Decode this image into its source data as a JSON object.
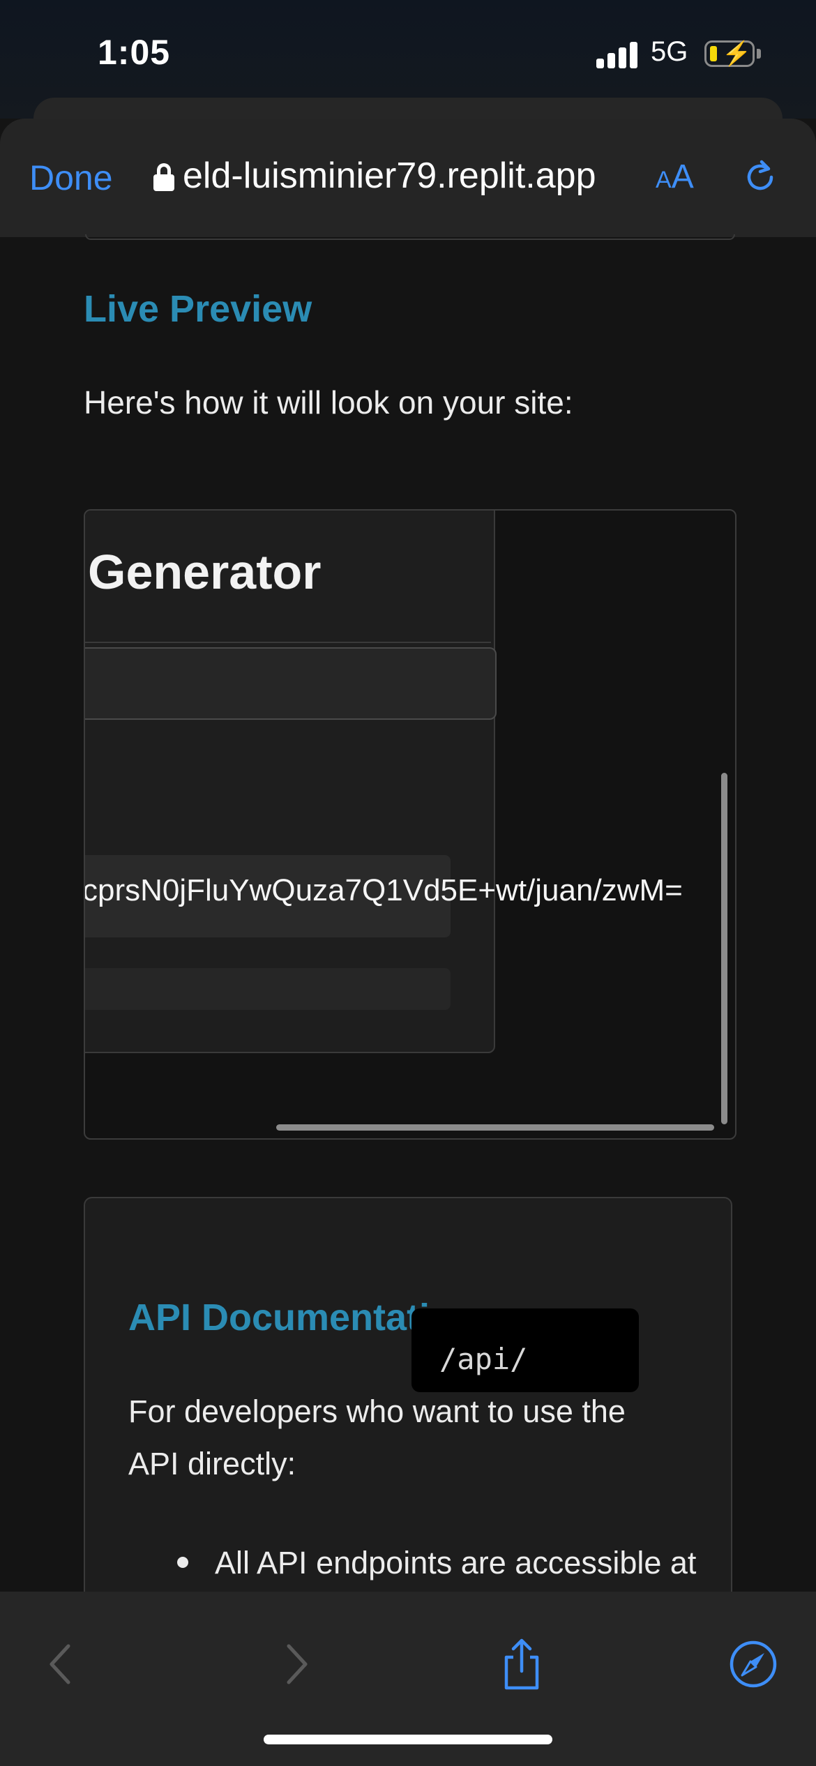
{
  "status_bar": {
    "time": "1:05",
    "network": "5G"
  },
  "browser": {
    "done_label": "Done",
    "url": "eld-luisminier79.replit.app",
    "text_size_small": "A",
    "text_size_big": "A"
  },
  "page": {
    "live_preview_heading": "Live Preview",
    "live_preview_desc": "Here's how it will look on your site:",
    "preview": {
      "title": "Generator",
      "code": "cprsN0jFluYwQuza7Q1Vd5E+wt/juan/zwM="
    },
    "api": {
      "heading": "API Documentation",
      "desc": "For developers who want to use the API directly:",
      "bullet_1": "All API endpoints are accessible at",
      "code_chip": "/api/"
    }
  },
  "colors": {
    "accent_blue": "#3e8ef7",
    "heading_teal": "#2b8cb4",
    "background": "#141414"
  },
  "icons": [
    "lock-icon",
    "reload-icon",
    "back-icon",
    "forward-icon",
    "share-icon",
    "compass-icon"
  ]
}
